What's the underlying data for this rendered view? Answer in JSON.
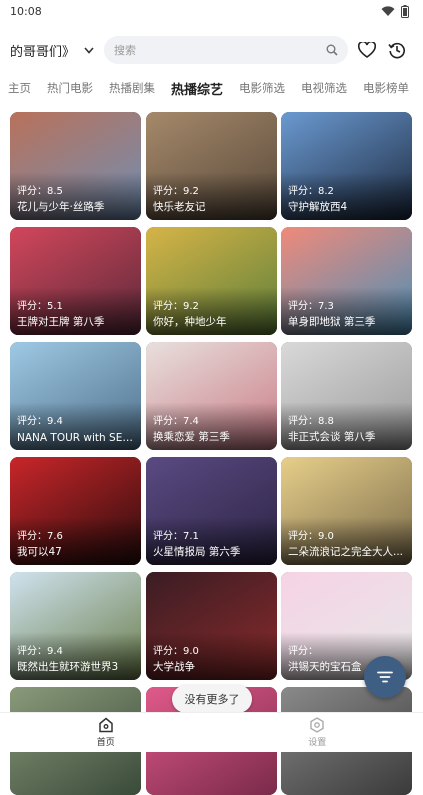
{
  "status": {
    "time": "10:08"
  },
  "header": {
    "site_name": "的哥哥们》",
    "search_placeholder": "搜索"
  },
  "tabs": [
    {
      "label": "主页"
    },
    {
      "label": "热门电影"
    },
    {
      "label": "热播剧集"
    },
    {
      "label": "热播综艺"
    },
    {
      "label": "电影筛选"
    },
    {
      "label": "电视筛选"
    },
    {
      "label": "电影榜单"
    }
  ],
  "active_tab": "热播综艺",
  "cards": [
    {
      "rating": "评分：8.5",
      "title": "花儿与少年·丝路季",
      "colors": [
        "#b9715a",
        "#6f8fb4"
      ]
    },
    {
      "rating": "评分：9.2",
      "title": "快乐老友记",
      "colors": [
        "#a6896a",
        "#56483a"
      ]
    },
    {
      "rating": "评分：8.2",
      "title": "守护解放西4",
      "colors": [
        "#6b9ad1",
        "#1d2a40"
      ]
    },
    {
      "rating": "评分：5.1",
      "title": "王牌对王牌 第八季",
      "colors": [
        "#d2465b",
        "#5a2a3a"
      ]
    },
    {
      "rating": "评分：9.2",
      "title": "你好，种地少年",
      "colors": [
        "#d6b447",
        "#5d7f3a"
      ]
    },
    {
      "rating": "评分：7.3",
      "title": "单身即地狱 第三季",
      "colors": [
        "#f08a7a",
        "#4a8fb8"
      ]
    },
    {
      "rating": "评分：9.4",
      "title": "NANA TOUR with SEV...",
      "colors": [
        "#9ec9e4",
        "#4f6f8a"
      ]
    },
    {
      "rating": "评分：7.4",
      "title": "换乘恋爱 第三季",
      "colors": [
        "#e8e0dd",
        "#c97b86"
      ]
    },
    {
      "rating": "评分：8.8",
      "title": "非正式会谈 第八季",
      "colors": [
        "#d9d9d9",
        "#9a9a9a"
      ]
    },
    {
      "rating": "评分：7.6",
      "title": "我可以47",
      "colors": [
        "#c9262a",
        "#2a0c0c"
      ]
    },
    {
      "rating": "评分：7.1",
      "title": "火星情报局 第六季",
      "colors": [
        "#5a4a82",
        "#2c2444"
      ]
    },
    {
      "rating": "评分：9.0",
      "title": "二朵流浪记之完全大人...",
      "colors": [
        "#e7cf8a",
        "#7a6a4a"
      ]
    },
    {
      "rating": "评分：9.4",
      "title": "既然出生就环游世界3",
      "colors": [
        "#cfe2ee",
        "#6a7d4a"
      ]
    },
    {
      "rating": "评分：9.0",
      "title": "大学战争",
      "colors": [
        "#3a1d24",
        "#8a2a2a"
      ]
    },
    {
      "rating": "评分：",
      "title": "洪锡天的宝石盒",
      "colors": [
        "#f6d3e6",
        "#e7e7e7"
      ]
    },
    {
      "rating": "",
      "title": "",
      "colors": [
        "#8a9a7a",
        "#3a4a3a"
      ]
    },
    {
      "rating": "",
      "title": "",
      "colors": [
        "#e05a8a",
        "#7a2a4a"
      ]
    },
    {
      "rating": "",
      "title": "",
      "colors": [
        "#8a8a8a",
        "#3a3a3a"
      ]
    }
  ],
  "toast": {
    "text": "没有更多了"
  },
  "bottom_nav": [
    {
      "label": "首页",
      "icon": "home-icon"
    },
    {
      "label": "设置",
      "icon": "settings-icon"
    }
  ]
}
